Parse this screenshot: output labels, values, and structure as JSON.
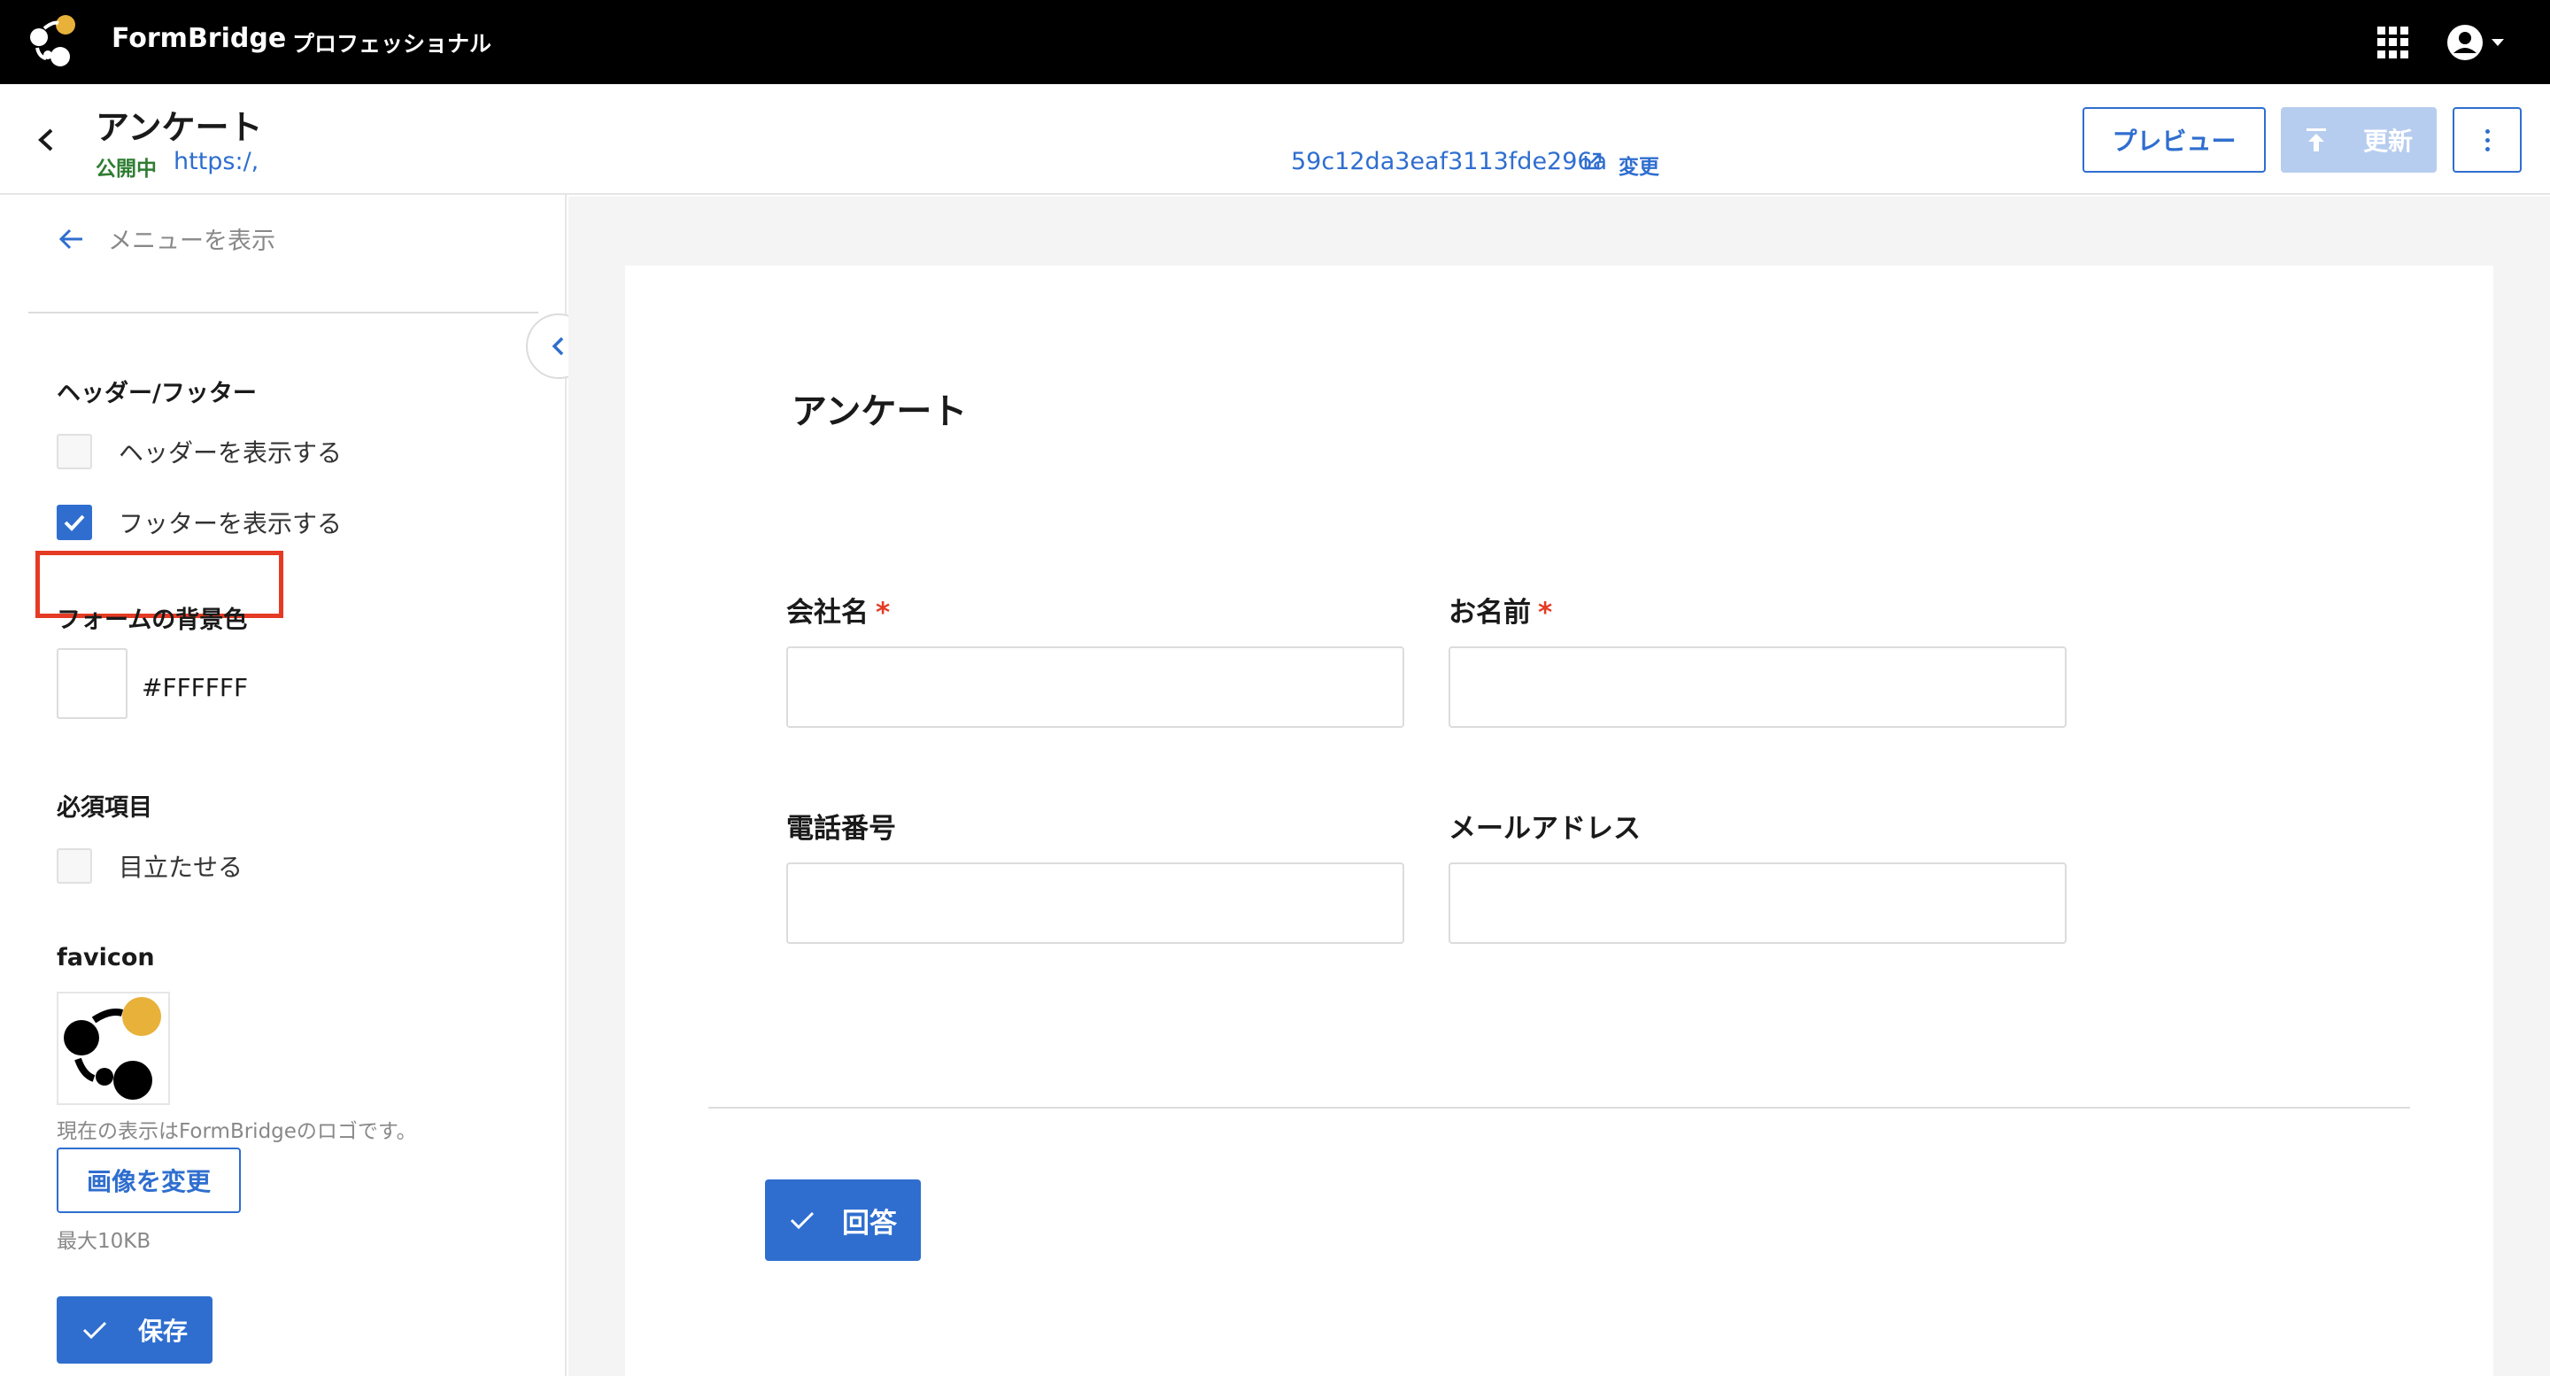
{
  "app": {
    "brand": "FormBridge",
    "plan": "プロフェッショナル"
  },
  "header": {
    "title": "アンケート",
    "status": "公開中",
    "url_start": "https:/,",
    "url_end": "59c12da3eaf3113fde296a",
    "change_link": "変更",
    "preview_label": "プレビュー",
    "update_label": "更新"
  },
  "sidebar": {
    "menu_link": "メニューを表示",
    "header_footer_title": "ヘッダー/フッター",
    "show_header_label": "ヘッダーを表示する",
    "show_header_checked": false,
    "show_footer_label": "フッターを表示する",
    "show_footer_checked": true,
    "bg_color_title": "フォームの背景色",
    "bg_color_value": "#FFFFFF",
    "required_title": "必須項目",
    "highlight_label": "目立たせる",
    "highlight_checked": false,
    "favicon_title": "favicon",
    "favicon_note": "現在の表示はFormBridgeのロゴです。",
    "change_image_label": "画像を変更",
    "max_size": "最大10KB",
    "save_label": "保存"
  },
  "form": {
    "title": "アンケート",
    "fields": [
      {
        "label": "会社名",
        "required": "*",
        "value": ""
      },
      {
        "label": "お名前",
        "required": "*",
        "value": ""
      },
      {
        "label": "電話番号",
        "value": ""
      },
      {
        "label": "メールアドレス",
        "value": ""
      }
    ],
    "submit_label": "回答"
  },
  "colors": {
    "accent": "#2f6ecf",
    "highlight_border": "#e53b24",
    "status_green": "#2e7d32",
    "logo_yellow": "#e8b13a"
  }
}
